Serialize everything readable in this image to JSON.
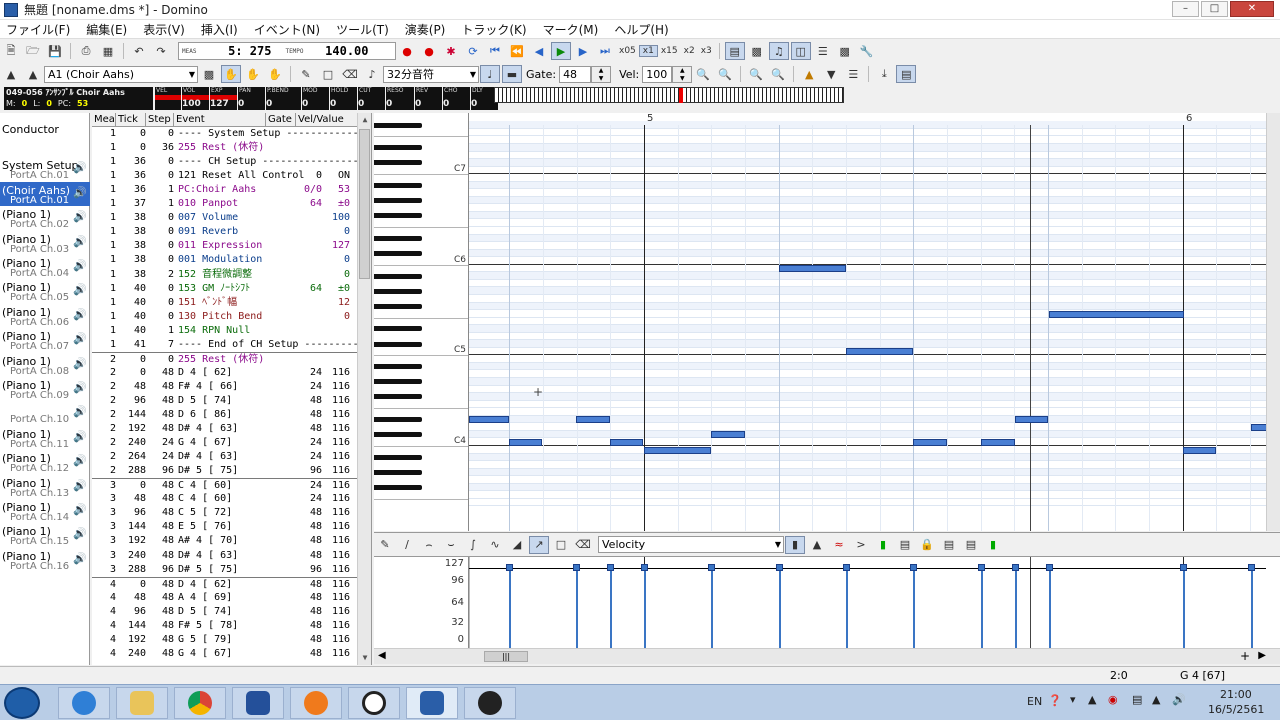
{
  "window": {
    "title": "無題 [noname.dms *] - Domino"
  },
  "menu": [
    "ファイル(F)",
    "編集(E)",
    "表示(V)",
    "挿入(I)",
    "イベント(N)",
    "ツール(T)",
    "演奏(P)",
    "トラック(K)",
    "マーク(M)",
    "ヘルプ(H)"
  ],
  "transport": {
    "meas_label": "MEAS",
    "meas_value": "5: 275",
    "tempo_label": "TEMPO",
    "tempo_value": "140.00",
    "speeds": [
      "x05",
      "x1",
      "x15",
      "x2",
      "x3"
    ],
    "active_speed": "x1"
  },
  "toolbar2": {
    "track_combo": "A1  (Choir Aahs)",
    "note_len": "32分音符",
    "gate_label": "Gate:",
    "gate_value": "48",
    "vel_label": "Vel:",
    "vel_value": "100"
  },
  "track_info": {
    "line1": "049-056 ｱﾝｻﾝﾌﾞﾙ Choir Aahs",
    "m_label": "M:",
    "m_val": "0",
    "l_label": "L:",
    "l_val": "0",
    "pc_label": "PC:",
    "pc_val": "53"
  },
  "meters": [
    {
      "label": "VEL",
      "value": "",
      "on": true
    },
    {
      "label": "VOL",
      "value": "100",
      "on": true
    },
    {
      "label": "EXP",
      "value": "127",
      "on": true
    },
    {
      "label": "PAN",
      "value": "0",
      "on": false
    },
    {
      "label": "P.BEND",
      "value": "0",
      "on": false
    },
    {
      "label": "MOD",
      "value": "0",
      "on": false
    },
    {
      "label": "HOLD",
      "value": "0",
      "on": false
    },
    {
      "label": "CUT",
      "value": "0",
      "on": false
    },
    {
      "label": "RESO",
      "value": "0",
      "on": false
    },
    {
      "label": "REV",
      "value": "0",
      "on": false
    },
    {
      "label": "CHO",
      "value": "0",
      "on": false
    },
    {
      "label": "DLY",
      "value": "0",
      "on": false
    }
  ],
  "tracks": [
    {
      "name": "Conductor",
      "port": ""
    },
    {
      "name": "System Setup",
      "port": "PortA  Ch.01"
    },
    {
      "name": "(Choir Aahs)",
      "port": "PortA  Ch.01",
      "selected": true
    },
    {
      "name": "(Piano 1)",
      "port": "PortA  Ch.02"
    },
    {
      "name": "(Piano 1)",
      "port": "PortA  Ch.03"
    },
    {
      "name": "(Piano 1)",
      "port": "PortA  Ch.04"
    },
    {
      "name": "(Piano 1)",
      "port": "PortA  Ch.05"
    },
    {
      "name": "(Piano 1)",
      "port": "PortA  Ch.06"
    },
    {
      "name": "(Piano 1)",
      "port": "PortA  Ch.07"
    },
    {
      "name": "(Piano 1)",
      "port": "PortA  Ch.08"
    },
    {
      "name": "(Piano 1)",
      "port": "PortA  Ch.09"
    },
    {
      "name": "",
      "port": "PortA  Ch.10"
    },
    {
      "name": "(Piano 1)",
      "port": "PortA  Ch.11"
    },
    {
      "name": "(Piano 1)",
      "port": "PortA  Ch.12"
    },
    {
      "name": "(Piano 1)",
      "port": "PortA  Ch.13"
    },
    {
      "name": "(Piano 1)",
      "port": "PortA  Ch.14"
    },
    {
      "name": "(Piano 1)",
      "port": "PortA  Ch.15"
    },
    {
      "name": "(Piano 1)",
      "port": "PortA  Ch.16"
    }
  ],
  "event_headers": [
    "Mea",
    "Tick",
    "Step",
    "Event",
    "Gate",
    "Vel/Value"
  ],
  "events": [
    {
      "m": "1",
      "t": "0",
      "s": "0",
      "e": "---- System Setup -------------",
      "g": "",
      "v": "",
      "c": "#000"
    },
    {
      "m": "1",
      "t": "0",
      "s": "36",
      "e": "255 Rest (休符)",
      "g": "",
      "v": "",
      "c": "#8b0a8b"
    },
    {
      "m": "1",
      "t": "36",
      "s": "0",
      "e": "---- CH Setup ------------------",
      "g": "",
      "v": "",
      "c": "#000"
    },
    {
      "m": "1",
      "t": "36",
      "s": "0",
      "e": "121 Reset All Control",
      "g": "0",
      "v": "ON",
      "c": "#000"
    },
    {
      "m": "1",
      "t": "36",
      "s": "1",
      "e": "PC:Choir Aahs",
      "g": "0/0",
      "v": "53",
      "c": "#8b0a8b"
    },
    {
      "m": "1",
      "t": "37",
      "s": "1",
      "e": "010 Panpot",
      "g": "64",
      "v": "±0",
      "c": "#8b0a8b"
    },
    {
      "m": "1",
      "t": "38",
      "s": "0",
      "e": "007 Volume",
      "g": "",
      "v": "100",
      "c": "#0a3d8b"
    },
    {
      "m": "1",
      "t": "38",
      "s": "0",
      "e": "091 Reverb",
      "g": "",
      "v": "0",
      "c": "#0a3d8b"
    },
    {
      "m": "1",
      "t": "38",
      "s": "0",
      "e": "011 Expression",
      "g": "",
      "v": "127",
      "c": "#8b0a8b"
    },
    {
      "m": "1",
      "t": "38",
      "s": "0",
      "e": "001 Modulation",
      "g": "",
      "v": "0",
      "c": "#0a3d8b"
    },
    {
      "m": "1",
      "t": "38",
      "s": "2",
      "e": "152 音程微調整",
      "g": "",
      "v": "0",
      "c": "#0a6b0a"
    },
    {
      "m": "1",
      "t": "40",
      "s": "0",
      "e": "153 GM ﾉｰﾄｼﾌﾄ",
      "g": "64",
      "v": "±0",
      "c": "#0a6b0a"
    },
    {
      "m": "1",
      "t": "40",
      "s": "0",
      "e": "151 ﾍﾞﾝﾄﾞ幅",
      "g": "",
      "v": "12",
      "c": "#8b1a1a"
    },
    {
      "m": "1",
      "t": "40",
      "s": "0",
      "e": "130 Pitch Bend",
      "g": "",
      "v": "0",
      "c": "#8b1a1a"
    },
    {
      "m": "1",
      "t": "40",
      "s": "1",
      "e": "154 RPN Null",
      "g": "",
      "v": "",
      "c": "#0a6b0a"
    },
    {
      "m": "1",
      "t": "41",
      "s": "7",
      "e": "---- End of CH Setup ----------",
      "g": "",
      "v": "",
      "c": "#000"
    },
    {
      "m": "2",
      "t": "0",
      "s": "0",
      "e": "255 Rest (休符)",
      "g": "",
      "v": "",
      "c": "#8b0a8b"
    },
    {
      "m": "2",
      "t": "0",
      "s": "48",
      "e": "D  4 [ 62]",
      "g": "24",
      "v": "116",
      "c": "#000"
    },
    {
      "m": "2",
      "t": "48",
      "s": "48",
      "e": "F# 4 [ 66]",
      "g": "24",
      "v": "116",
      "c": "#000"
    },
    {
      "m": "2",
      "t": "96",
      "s": "48",
      "e": "D  5 [ 74]",
      "g": "48",
      "v": "116",
      "c": "#000"
    },
    {
      "m": "2",
      "t": "144",
      "s": "48",
      "e": "D  6 [ 86]",
      "g": "48",
      "v": "116",
      "c": "#000"
    },
    {
      "m": "2",
      "t": "192",
      "s": "48",
      "e": "D# 4 [ 63]",
      "g": "48",
      "v": "116",
      "c": "#000"
    },
    {
      "m": "2",
      "t": "240",
      "s": "24",
      "e": "G  4 [ 67]",
      "g": "24",
      "v": "116",
      "c": "#000"
    },
    {
      "m": "2",
      "t": "264",
      "s": "24",
      "e": "D# 4 [ 63]",
      "g": "24",
      "v": "116",
      "c": "#000"
    },
    {
      "m": "2",
      "t": "288",
      "s": "96",
      "e": "D# 5 [ 75]",
      "g": "96",
      "v": "116",
      "c": "#000"
    },
    {
      "m": "3",
      "t": "0",
      "s": "48",
      "e": "C  4 [ 60]",
      "g": "24",
      "v": "116",
      "c": "#000"
    },
    {
      "m": "3",
      "t": "48",
      "s": "48",
      "e": "C  4 [ 60]",
      "g": "24",
      "v": "116",
      "c": "#000"
    },
    {
      "m": "3",
      "t": "96",
      "s": "48",
      "e": "C  5 [ 72]",
      "g": "48",
      "v": "116",
      "c": "#000"
    },
    {
      "m": "3",
      "t": "144",
      "s": "48",
      "e": "E  5 [ 76]",
      "g": "48",
      "v": "116",
      "c": "#000"
    },
    {
      "m": "3",
      "t": "192",
      "s": "48",
      "e": "A# 4 [ 70]",
      "g": "48",
      "v": "116",
      "c": "#000"
    },
    {
      "m": "3",
      "t": "240",
      "s": "48",
      "e": "D# 4 [ 63]",
      "g": "48",
      "v": "116",
      "c": "#000"
    },
    {
      "m": "3",
      "t": "288",
      "s": "96",
      "e": "D# 5 [ 75]",
      "g": "96",
      "v": "116",
      "c": "#000"
    },
    {
      "m": "4",
      "t": "0",
      "s": "48",
      "e": "D  4 [ 62]",
      "g": "48",
      "v": "116",
      "c": "#000"
    },
    {
      "m": "4",
      "t": "48",
      "s": "48",
      "e": "A  4 [ 69]",
      "g": "48",
      "v": "116",
      "c": "#000"
    },
    {
      "m": "4",
      "t": "96",
      "s": "48",
      "e": "D  5 [ 74]",
      "g": "48",
      "v": "116",
      "c": "#000"
    },
    {
      "m": "4",
      "t": "144",
      "s": "48",
      "e": "F# 5 [ 78]",
      "g": "48",
      "v": "116",
      "c": "#000"
    },
    {
      "m": "4",
      "t": "192",
      "s": "48",
      "e": "G  5 [ 79]",
      "g": "48",
      "v": "116",
      "c": "#000"
    },
    {
      "m": "4",
      "t": "240",
      "s": "48",
      "e": "G  4 [ 67]",
      "g": "48",
      "v": "116",
      "c": "#000"
    }
  ],
  "octave_labels": [
    "C7",
    "C6",
    "C5",
    "C4"
  ],
  "measure_labels": [
    "5",
    "6"
  ],
  "ctrl": {
    "selector": "Velocity",
    "ticks": [
      "127",
      "96",
      "64",
      "32",
      "0"
    ]
  },
  "status": {
    "pos": "2:0",
    "note": "G 4 [67]"
  },
  "tray": {
    "lang": "EN",
    "time": "21:00",
    "date": "16/5/2561"
  },
  "colors": {
    "note": "#4a7fd3",
    "selected_track": "#3069c8",
    "meter_on": "#dd0000"
  }
}
